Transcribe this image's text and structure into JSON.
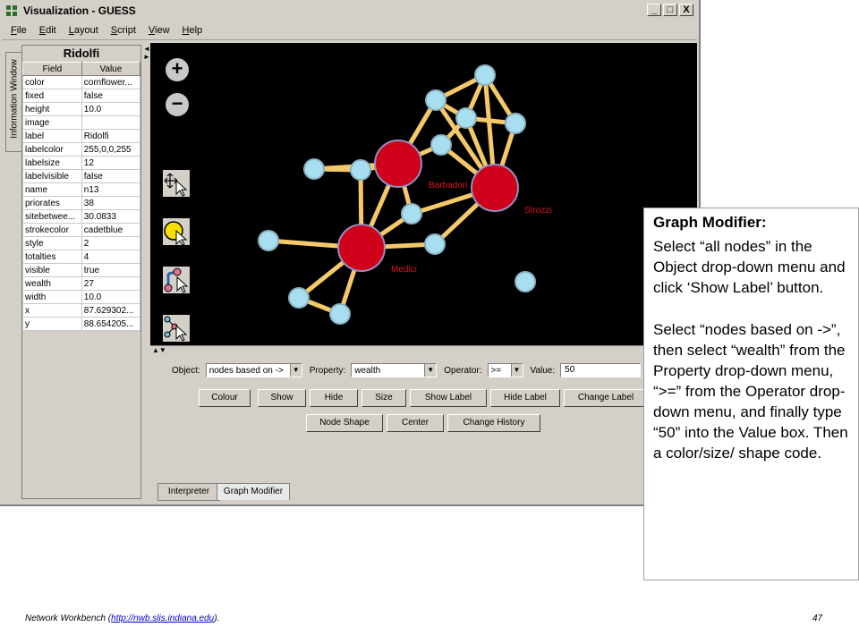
{
  "window": {
    "title": "Visualization - GUESS",
    "controls": {
      "minimize": "_",
      "maximize": "□",
      "close": "X"
    }
  },
  "menu": [
    "File",
    "Edit",
    "Layout",
    "Script",
    "View",
    "Help"
  ],
  "info_window": {
    "tab_label": "Information Window",
    "title": "Ridolfi",
    "headers": {
      "field": "Field",
      "value": "Value"
    },
    "rows": [
      {
        "field": "color",
        "value": "cornflower..."
      },
      {
        "field": "fixed",
        "value": "false"
      },
      {
        "field": "height",
        "value": "10.0"
      },
      {
        "field": "image",
        "value": ""
      },
      {
        "field": "label",
        "value": "Ridolfi"
      },
      {
        "field": "labelcolor",
        "value": "255,0,0,255"
      },
      {
        "field": "labelsize",
        "value": "12"
      },
      {
        "field": "labelvisible",
        "value": "false"
      },
      {
        "field": "name",
        "value": "n13"
      },
      {
        "field": "priorates",
        "value": "38"
      },
      {
        "field": "sitebetwee...",
        "value": "30.0833"
      },
      {
        "field": "strokecolor",
        "value": "cadetblue"
      },
      {
        "field": "style",
        "value": "2"
      },
      {
        "field": "totalties",
        "value": "4"
      },
      {
        "field": "visible",
        "value": "true"
      },
      {
        "field": "wealth",
        "value": "27"
      },
      {
        "field": "width",
        "value": "10.0"
      },
      {
        "field": "x",
        "value": "87.629302..."
      },
      {
        "field": "y",
        "value": "88.654205..."
      }
    ]
  },
  "graph": {
    "node_labels": {
      "barbadori": "Barbadori",
      "strozzi": "Strozzi",
      "medici": "Medici"
    },
    "colors": {
      "background": "#000000",
      "edge": "#f5c96a",
      "node_small": "#a8dff0",
      "node_big": "#d0021b",
      "label": "#e01020"
    }
  },
  "tools": {
    "zoom_in": "zoom-in-icon",
    "zoom_out": "zoom-out-icon",
    "move": "move-icon",
    "select": "select-icon",
    "edge_edit": "edge-edit-icon",
    "node_edit": "node-edit-icon"
  },
  "graph_modifier": {
    "object_label": "Object:",
    "object_value": "nodes based on ->",
    "property_label": "Property:",
    "property_value": "wealth",
    "operator_label": "Operator:",
    "operator_value": ">=",
    "value_label": "Value:",
    "value_value": "50",
    "buttons_row1": [
      "Colour",
      "Show",
      "Hide",
      "Size",
      "Show Label",
      "Hide Label",
      "Change Label"
    ],
    "buttons_row2": [
      "Node Shape",
      "Center",
      "Change History"
    ]
  },
  "bottom_tabs": [
    "Interpreter",
    "Graph Modifier"
  ],
  "callout": {
    "heading": "Graph Modifier:",
    "para1": "Select “all nodes” in the Object drop-down menu and click ‘Show Label’ button.",
    "para2": "Select “nodes based on ->”, then select “wealth” from the Property drop-down menu, “>=” from the Operator drop-down menu, and finally type “50” into the Value box. Then a color/size/ shape code."
  },
  "footer": {
    "prefix": "Network Workbench (",
    "link": "http://nwb.slis.indiana.edu",
    "suffix": ").",
    "page": "47"
  }
}
